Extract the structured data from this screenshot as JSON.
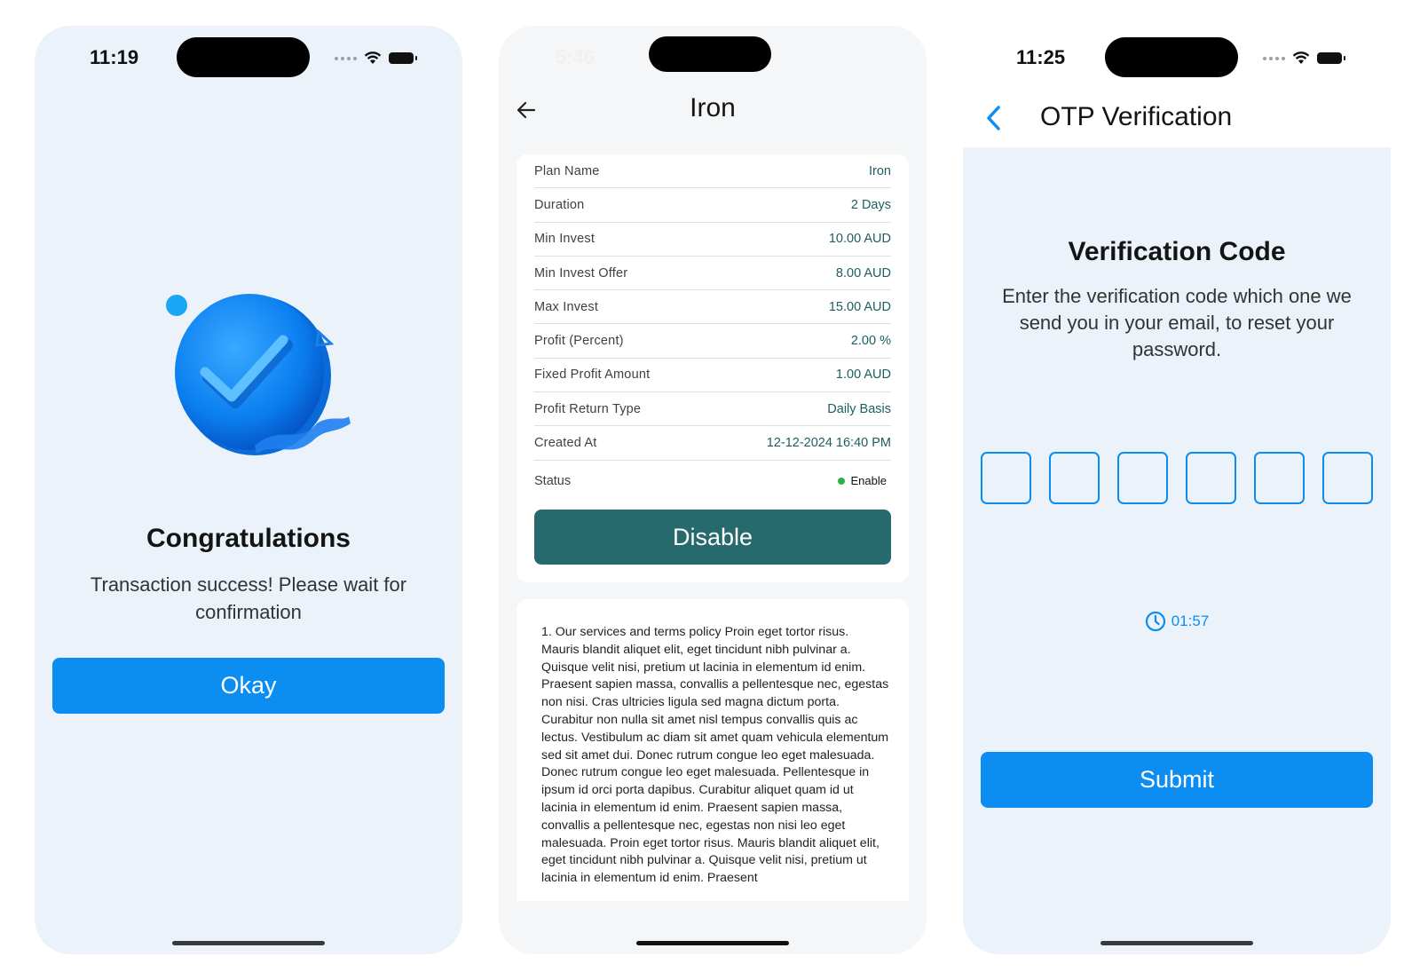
{
  "success_screen": {
    "status_time": "11:19",
    "title": "Congratulations",
    "message": "Transaction success! Please wait for confirmation",
    "button_label": "Okay"
  },
  "plan_screen": {
    "status_time": "5:46",
    "title": "Iron",
    "details": [
      {
        "label": "Plan Name",
        "value": "Iron"
      },
      {
        "label": "Duration",
        "value": "2 Days"
      },
      {
        "label": "Min Invest",
        "value": "10.00 AUD"
      },
      {
        "label": "Min Invest Offer",
        "value": "8.00 AUD"
      },
      {
        "label": "Max Invest",
        "value": "15.00 AUD"
      },
      {
        "label": "Profit (Percent)",
        "value": "2.00 %"
      },
      {
        "label": "Fixed Profit Amount",
        "value": "1.00 AUD"
      },
      {
        "label": "Profit Return Type",
        "value": "Daily Basis"
      },
      {
        "label": "Created At",
        "value": "12-12-2024 16:40 PM"
      }
    ],
    "status_label": "Status",
    "status_value": "Enable",
    "status_color": "#2bb24c",
    "button_label": "Disable",
    "policy_text": "1. Our services and terms policy Proin eget tortor risus. Mauris blandit aliquet elit, eget tincidunt nibh pulvinar a. Quisque velit nisi, pretium ut lacinia in elementum id enim. Praesent sapien massa, convallis a pellentesque nec, egestas non nisi. Cras ultricies ligula sed magna dictum porta. Curabitur non nulla sit amet nisl tempus convallis quis ac lectus. Vestibulum ac diam sit amet quam vehicula elementum sed sit amet dui. Donec rutrum congue leo eget malesuada. Donec rutrum congue leo eget malesuada. Pellentesque in ipsum id orci porta dapibus. Curabitur aliquet quam id ut lacinia in elementum id enim. Praesent sapien massa, convallis a pellentesque nec, egestas non nisi leo eget malesuada. Proin eget tortor risus. Mauris blandit aliquet elit, eget tincidunt nibh pulvinar a. Quisque velit nisi, pretium ut lacinia in elementum id enim. Praesent"
  },
  "otp_screen": {
    "status_time": "11:25",
    "title": "OTP Verification",
    "heading": "Verification Code",
    "message": "Enter the verification code which one we send you in your email, to reset your password.",
    "otp_values": [
      "",
      "",
      "",
      "",
      "",
      ""
    ],
    "timer": "01:57",
    "button_label": "Submit"
  },
  "colors": {
    "primary": "#0b8df2",
    "teal": "#276a6e",
    "value_text": "#1d5e60"
  }
}
